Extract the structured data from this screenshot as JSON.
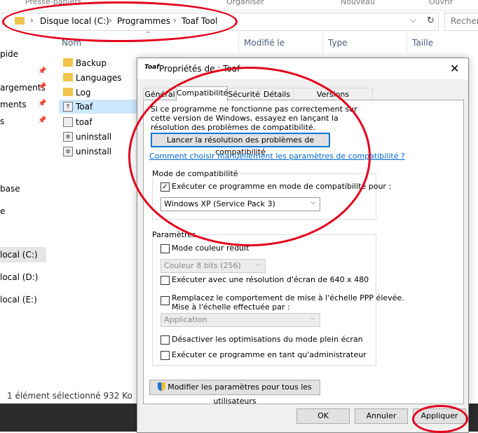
{
  "explorer": {
    "ribbon_tabs": [
      "Presse-papiers",
      "Organiser",
      "Nouveau",
      "Ouvrir"
    ],
    "address_crumbs": [
      "Disque local (C:)",
      "Programmes",
      "Toaf Tool"
    ],
    "search_placeholder": "Recherc",
    "nav_items": [
      "pide",
      "argements",
      "ments",
      "s",
      "base",
      "e",
      "local (C:)",
      "local (D:)",
      "local (E:)"
    ],
    "columns": [
      "Nom",
      "Modifié le",
      "Type",
      "Taille"
    ],
    "files": [
      {
        "name": "Backup",
        "icon": "folder-icon"
      },
      {
        "name": "Languages",
        "icon": "folder-icon"
      },
      {
        "name": "Log",
        "icon": "folder-icon"
      },
      {
        "name": "Toaf",
        "icon": "app-icon"
      },
      {
        "name": "toaf",
        "icon": "file-icon"
      },
      {
        "name": "uninstall",
        "icon": "setup-icon"
      },
      {
        "name": "uninstall",
        "icon": "setup-icon"
      }
    ],
    "status": "1 élément sélectionné  932 Ko"
  },
  "dialog": {
    "app_icon_text": "Toaf",
    "title": "Propriétés de : Toaf",
    "tabs": [
      "Général",
      "Compatibilité",
      "Sécurité",
      "Détails",
      "Versions précédentes"
    ],
    "info_text": "Si ce programme ne fonctionne pas correctement sur cette version de Windows, essayez en lançant la résolution des problèmes de compatibilité.",
    "troubleshoot_button": "Lancer la résolution des problèmes de compatibilité",
    "manual_link": "Comment choisir manuellement les paramètres de compatibilité ?",
    "compat_mode": {
      "label": "Mode de compatibilité",
      "checkbox": "Exécuter ce programme en mode de compatibilité pour :",
      "selected_os": "Windows XP (Service Pack 3)"
    },
    "settings": {
      "label": "Paramètres",
      "reduced_color": "Mode couleur réduit",
      "color_select": "Couleur 8 bits (256)",
      "res_640": "Exécuter avec une résolution d'écran de 640 x 480",
      "dpi_line1": "Remplacez le comportement de mise à l'échelle PPP élevée.",
      "dpi_line2": "Mise à l'échelle effectuée par :",
      "dpi_select": "Application",
      "fullscreen": "Désactiver les optimisations du mode plein écran",
      "admin": "Exécuter ce programme en tant qu'administrateur"
    },
    "all_users_button": "Modifier les paramètres pour tous les utilisateurs",
    "ok": "OK",
    "cancel": "Annuler",
    "apply": "Appliquer"
  },
  "colors": {
    "annotation": "#e3001b",
    "link": "#0066cc",
    "focus": "#0078d7",
    "selection": "#cce8ff"
  }
}
